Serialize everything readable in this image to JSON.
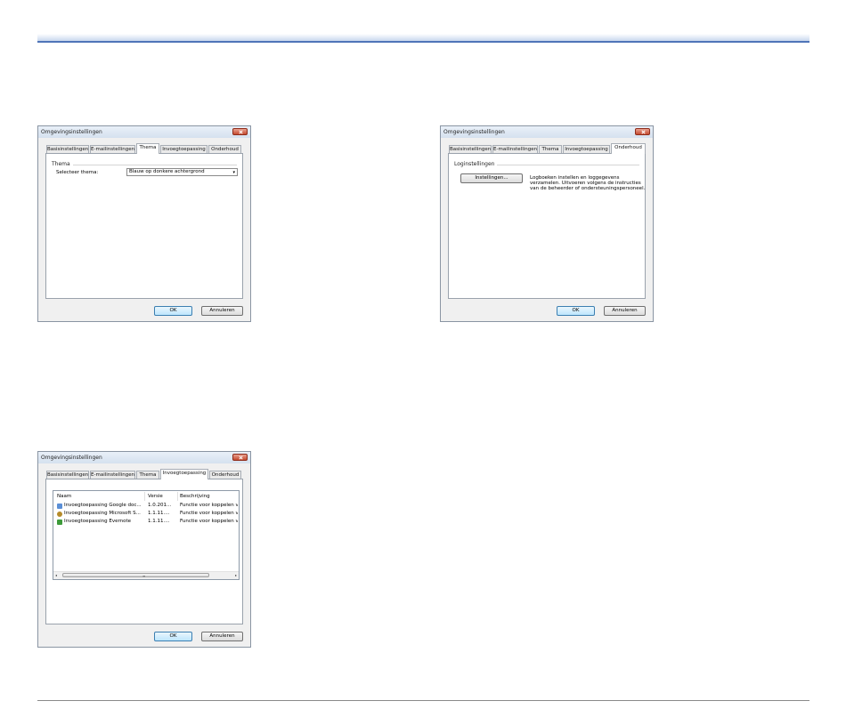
{
  "dialog_title": "Omgevingsinstellingen",
  "tabs": {
    "basis": "Basisinstellingen",
    "email": "E-mailinstellingen",
    "thema": "Thema",
    "invoeg": "Invoegtoepassing",
    "onderhoud": "Onderhoud"
  },
  "buttons": {
    "ok": "OK",
    "cancel": "Annuleren"
  },
  "thema_panel": {
    "group": "Thema",
    "select_label": "Selecteer thema:",
    "select_value": "Blauw op donkere achtergrond"
  },
  "onderhoud_panel": {
    "group": "Loginstellingen",
    "settings_button": "Instellingen...",
    "description": "Logboeken instellen en loggegevens verzamelen. Uitvoeren volgens de instructies van de beheerder of ondersteuningspersoneel."
  },
  "plugin_panel": {
    "columns": {
      "name": "Naam",
      "version": "Versie",
      "description": "Beschrijving"
    },
    "rows": [
      {
        "name": "Invoegtoepassing Google doc...",
        "version": "1.0.201...",
        "description": "Functie voor koppelen v",
        "icon": "google-docs-icon",
        "color": "#5b8fd6"
      },
      {
        "name": "Invoegtoepassing Microsoft S...",
        "version": "1.1.11....",
        "description": "Functie voor koppelen v",
        "icon": "sharepoint-icon",
        "color": "#b58b2a"
      },
      {
        "name": "Invoegtoepassing Evernote",
        "version": "1.1.11....",
        "description": "Functie voor koppelen v",
        "icon": "evernote-icon",
        "color": "#3d9a3a"
      }
    ],
    "scroll_left": "◂",
    "scroll_right": "▸",
    "scroll_grip": "≡"
  },
  "colors": {
    "accent_rule": "#4f74b8",
    "ok_border": "#3c7fb1",
    "close_red": "#c44a2f"
  }
}
